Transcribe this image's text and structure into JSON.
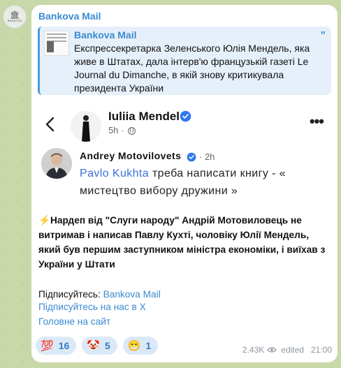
{
  "channel": {
    "name": "Bankova Mail",
    "avatar_text": "BANKOVA"
  },
  "reply": {
    "sender": "Bankova Mail",
    "text": "Експрессекретарка Зеленського Юлія Мендель, яка живе в Штатах, дала інтерв'ю французькій газеті Le Journal du Dimanche, в якій знову критикувала президента України"
  },
  "embed": {
    "profile_name": "Iuliia Mendel",
    "profile_time": "5h",
    "comment": {
      "author": "Andrey  Motovilovets",
      "time": "2h",
      "mention": "Pavlo Kukhta",
      "text": " треба написати книгу - « мистецтво вибору дружини »"
    }
  },
  "message": {
    "body": "⚡Нардеп від \"Слуги народу\" Андрій Мотовиловець не витримав і написав Павлу Кухті, чоловіку Юлії Мендель, який був першим заступником міністра економіки, і виїхав з України у Штати",
    "subscribe_prefix": "Підписуйтесь: ",
    "subscribe_link": "Bankova Mail",
    "link_x": "Підписуйтесь на нас в Х",
    "link_main": "Головне на сайт"
  },
  "reactions": [
    {
      "emoji": "💯",
      "count": "16"
    },
    {
      "emoji": "🤡",
      "count": "5"
    },
    {
      "emoji": "😁",
      "count": "1"
    }
  ],
  "footer": {
    "views": "2.43K",
    "edited": "edited",
    "time": "21:00"
  },
  "colors": {
    "accent": "#3a8ad1",
    "background": "#c9d8a9",
    "verified": "#2f78f0"
  }
}
